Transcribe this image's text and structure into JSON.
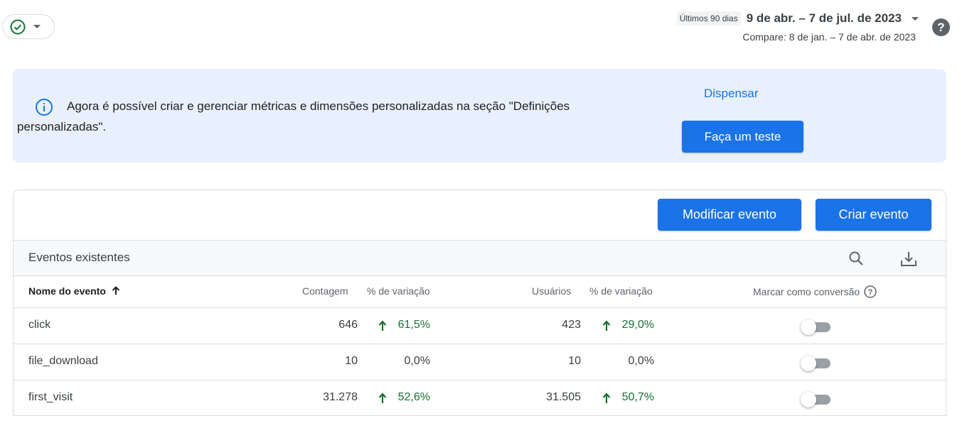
{
  "status": {
    "icon": "check-circle-icon",
    "color": "#137333"
  },
  "date_range": {
    "preset": "Últimos 90 dias",
    "range": "9 de abr. – 7 de jul. de 2023",
    "compare": "Compare: 8 de jan. – 7 de abr. de 2023"
  },
  "help": {
    "label": "?"
  },
  "banner": {
    "message": "Agora é possível criar e gerenciar métricas e dimensões personalizadas na seção \"Definições personalizadas\".",
    "dismiss": "Dispensar",
    "try_label": "Faça um teste"
  },
  "actions": {
    "modify": "Modificar evento",
    "create": "Criar evento"
  },
  "table": {
    "title": "Eventos existentes",
    "columns": {
      "name": "Nome do evento",
      "count": "Contagem",
      "count_change": "% de variação",
      "users": "Usuários",
      "users_change": "% de variação",
      "conversion": "Marcar como conversão"
    },
    "rows": [
      {
        "name": "click",
        "count": "646",
        "count_change": "61,5%",
        "count_up": true,
        "users": "423",
        "users_change": "29,0%",
        "users_up": true,
        "conversion": false
      },
      {
        "name": "file_download",
        "count": "10",
        "count_change": "0,0%",
        "count_up": false,
        "users": "10",
        "users_change": "0,0%",
        "users_up": false,
        "conversion": false
      },
      {
        "name": "first_visit",
        "count": "31.278",
        "count_change": "52,6%",
        "count_up": true,
        "users": "31.505",
        "users_change": "50,7%",
        "users_up": true,
        "conversion": false
      }
    ]
  },
  "colors": {
    "accent": "#1a73e8",
    "positive": "#137333",
    "banner_bg": "#e8f0fe"
  }
}
